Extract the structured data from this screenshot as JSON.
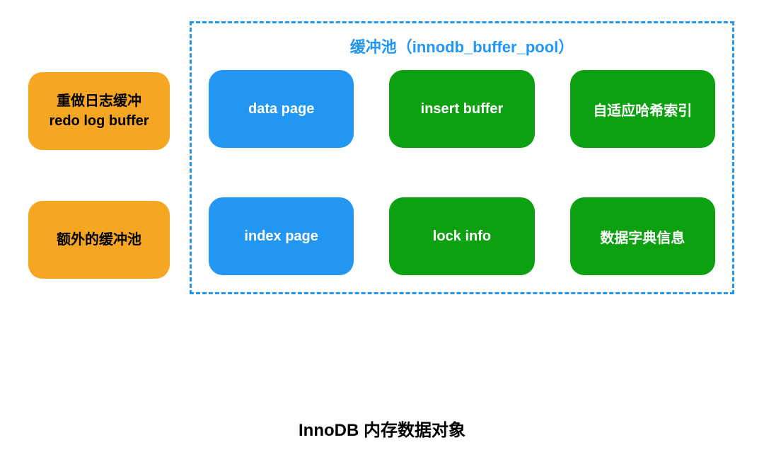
{
  "left_boxes": {
    "redo_log_line1": "重做日志缓冲",
    "redo_log_line2": "redo log buffer",
    "extra_pool": "额外的缓冲池"
  },
  "buffer_pool": {
    "title": "缓冲池（innodb_buffer_pool）",
    "row1": {
      "box1": "data page",
      "box2": "insert buffer",
      "box3": "自适应哈希索引"
    },
    "row2": {
      "box1": "index page",
      "box2": "lock info",
      "box3": "数据字典信息"
    }
  },
  "caption": "InnoDB 内存数据对象"
}
